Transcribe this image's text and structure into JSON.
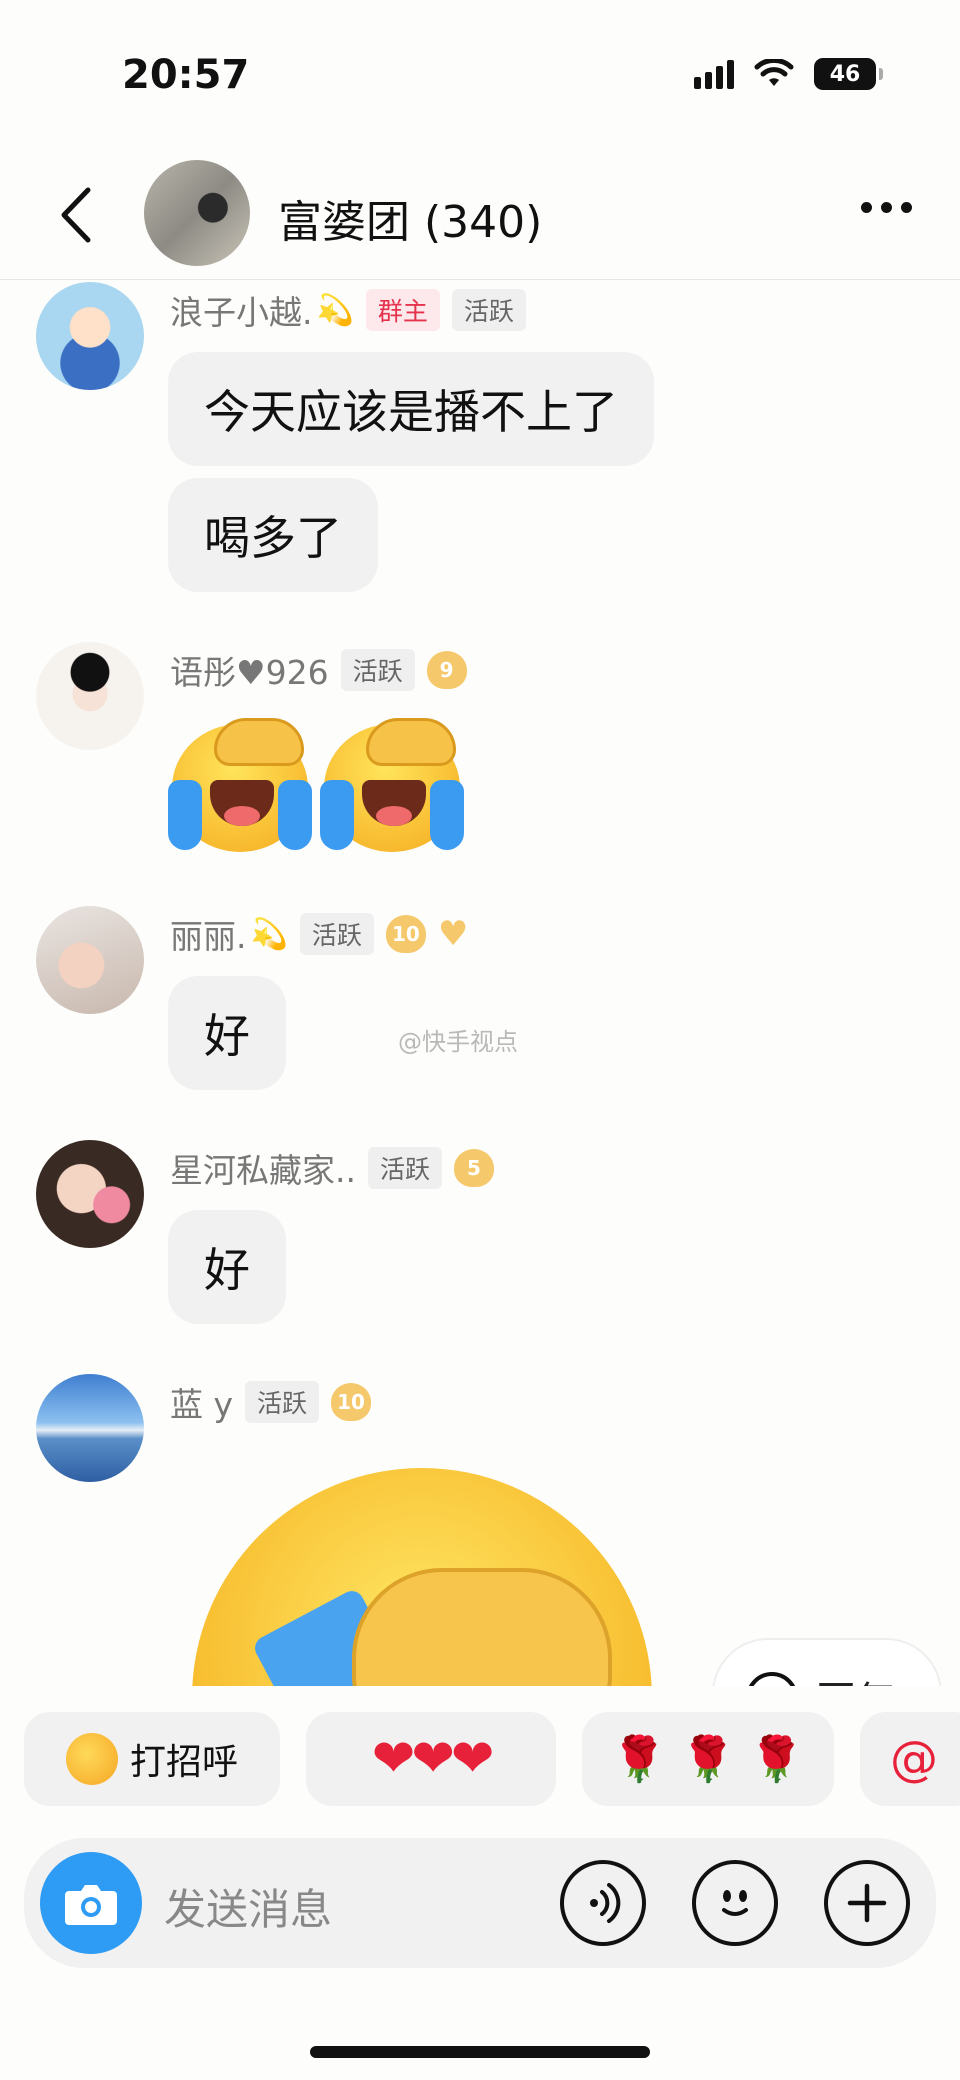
{
  "status_bar": {
    "time": "20:57",
    "battery": "46"
  },
  "header": {
    "title": "富婆团 (340)"
  },
  "messages": [
    {
      "name": "浪子小越.",
      "name_emoji": "💫",
      "tags": [
        "群主",
        "活跃"
      ],
      "bubbles": [
        "今天应该是播不上了",
        "喝多了"
      ]
    },
    {
      "name": "语彤♥926",
      "tags": [
        "活跃"
      ],
      "level": "9"
    },
    {
      "name": "丽丽.",
      "name_emoji": "💫",
      "tags": [
        "活跃"
      ],
      "level": "10",
      "bubbles": [
        "好"
      ]
    },
    {
      "name": "星河私藏家..",
      "tags": [
        "活跃"
      ],
      "level": "5",
      "bubbles": [
        "好"
      ]
    },
    {
      "name": "蓝 y",
      "tags": [
        "活跃"
      ],
      "level": "10"
    }
  ],
  "watermark": "@快手视点",
  "reply_chip": "回复",
  "quick_replies": [
    {
      "label": "打招呼"
    },
    {
      "label": "❤❤❤"
    },
    {
      "label": "🌹 🌹 🌹"
    },
    {
      "label": "@"
    }
  ],
  "input": {
    "placeholder": "发送消息"
  },
  "colors": {
    "accent": "#2e9cf4",
    "owner_tag": "#e6334d",
    "heart": "#e8213b"
  }
}
